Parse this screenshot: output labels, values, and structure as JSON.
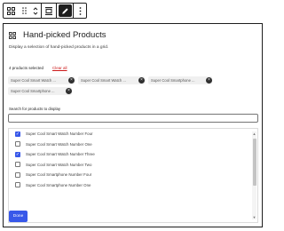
{
  "toolbar": {
    "buttons": [
      {
        "name": "block-type",
        "icon": "grid-icon"
      },
      {
        "name": "drag-handle",
        "icon": "drag-handle-icon"
      },
      {
        "name": "move",
        "icon": "chevron-up-down-icon"
      },
      {
        "name": "align",
        "icon": "align-icon"
      },
      {
        "name": "edit",
        "icon": "pencil-icon"
      },
      {
        "name": "options",
        "icon": "more-vertical-icon"
      }
    ]
  },
  "block": {
    "title": "Hand-picked Products",
    "description": "Display a selection of hand-picked products in a grid."
  },
  "selection": {
    "count_label": "4 products selected",
    "clear_label": "Clear all",
    "chips": [
      "Super Cool Smart Watch ...",
      "Super Cool Smart Watch ...",
      "Super Cool Smartphone ...",
      "Super Cool Smartphone ..."
    ]
  },
  "search": {
    "label": "Search for products to display",
    "value": "",
    "placeholder": ""
  },
  "products": [
    {
      "label": "Super Cool Smart Watch Number Four",
      "checked": true
    },
    {
      "label": "Super Cool Smart Watch Number One",
      "checked": false
    },
    {
      "label": "Super Cool Smart Watch Number Three",
      "checked": true
    },
    {
      "label": "Super Cool Smart Watch Number Two",
      "checked": false
    },
    {
      "label": "Super Cool Smartphone Number Four",
      "checked": false
    },
    {
      "label": "Super Cool Smartphone Number One",
      "checked": false
    }
  ],
  "done_label": "Done",
  "colors": {
    "accent": "#3858e9",
    "danger": "#cc1818",
    "border": "#1e1e1e"
  }
}
